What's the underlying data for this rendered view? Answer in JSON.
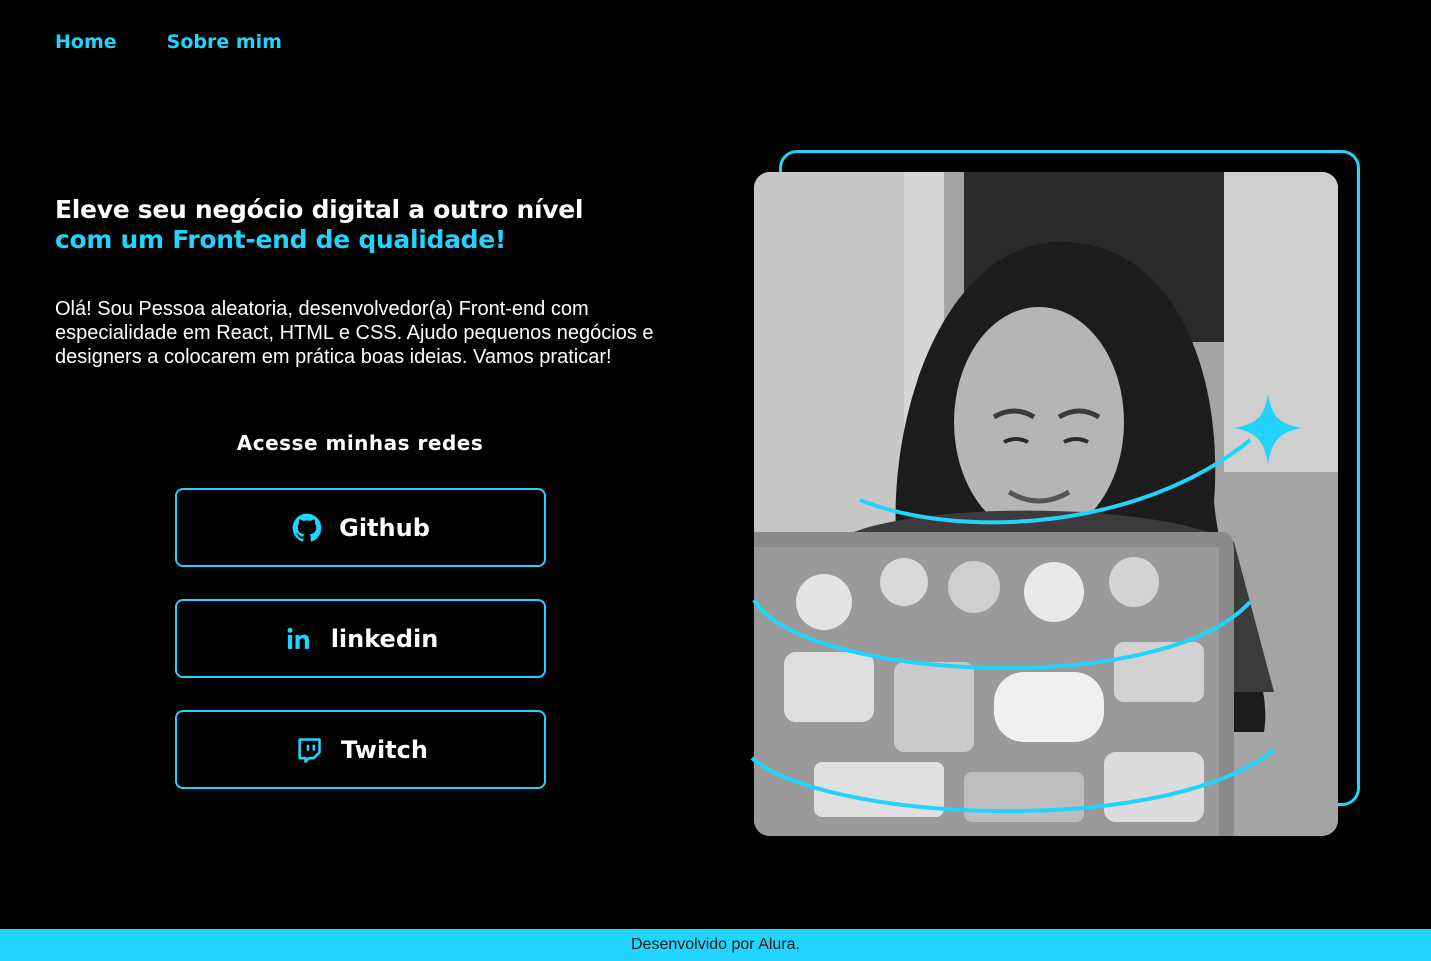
{
  "nav": {
    "items": [
      {
        "label": "Home"
      },
      {
        "label": "Sobre mim"
      }
    ]
  },
  "hero": {
    "headline_line1": "Eleve seu negócio digital a outro nível",
    "headline_line2": "com um Front-end de qualidade!",
    "intro": "Olá! Sou Pessoa aleatoria, desenvolvedor(a) Front-end com especialidade em React, HTML e CSS. Ajudo pequenos negócios e designers a colocarem em prática boas ideias. Vamos praticar!"
  },
  "social": {
    "title": "Acesse minhas redes",
    "buttons": [
      {
        "label": "Github",
        "icon": "github-icon"
      },
      {
        "label": "linkedin",
        "icon": "linkedin-icon"
      },
      {
        "label": "Twitch",
        "icon": "twitch-icon"
      }
    ]
  },
  "footer": {
    "text": "Desenvolvido por Alura."
  },
  "colors": {
    "accent": "#22d4fd",
    "background": "#000000",
    "text": "#ffffff"
  }
}
